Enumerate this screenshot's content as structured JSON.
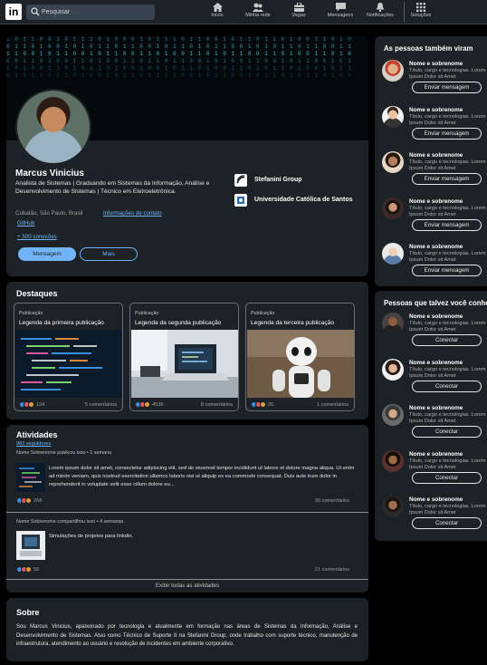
{
  "nav": {
    "logo": "in",
    "search_placeholder": "Pesquisar",
    "items": [
      {
        "label": "Início",
        "icon": "home-icon"
      },
      {
        "label": "Minha rede",
        "icon": "network-icon"
      },
      {
        "label": "Vagas",
        "icon": "briefcase-icon"
      },
      {
        "label": "Mensagens",
        "icon": "message-icon"
      },
      {
        "label": "Notificações",
        "icon": "bell-icon"
      },
      {
        "label": "Soluções",
        "icon": "grid-icon"
      }
    ]
  },
  "profile": {
    "name": "Marcus Vinicius",
    "headline": "Analista de Sistemas | Graduando em Sistemas da Informação, Análise e Desenvolvimento de Sistemas | Técnico em Eletroeletrônica.",
    "location": "Cubatão, São Paulo, Brasil",
    "contact_link": "Informações de contato",
    "github_link": "GitHub",
    "connections": "+ 500 conexões",
    "primary_button": "Mensagem",
    "secondary_button": "Mais",
    "company": "Stefanini Group",
    "education": "Universidade Católica de Santos"
  },
  "highlights": {
    "title": "Destaques",
    "posts": [
      {
        "type": "Publicação",
        "title": "Legenda da primeira publicação",
        "reactions": "124",
        "comments": "5 comentários"
      },
      {
        "type": "Publicação",
        "title": "Legenda da segunda publicação",
        "reactions": "4536",
        "comments": "8 comentários"
      },
      {
        "type": "Publicação",
        "title": "Legenda da terceira publicação",
        "reactions": "20",
        "comments": "1 comentários"
      }
    ]
  },
  "activities": {
    "title": "Atividades",
    "followers": "982 seguidores",
    "items": [
      {
        "meta": "Nome Sobrenome publicou isso • 1 semana",
        "text": "Lorem ipsum dolor sit amet, consectetur adipiscing elit, sed do eiusmod tempor incididunt ut labore et dolore magna aliqua. Ut enim ad minim veniam, quis nostrud exercitation ullamco laboris nisi ut aliquip ex ea commodo consequat. Duis aute irure dolor in reprehenderit in voluptate velit esse cillum dolore eu...",
        "reactions": "268",
        "comments": "30 comentários"
      },
      {
        "meta": "Nome Sobrenome compartilhou isso • 4 semanas",
        "text": "Simulações de projetos para linkdin.",
        "reactions": "56",
        "comments": "21 comentários"
      }
    ],
    "show_all": "Exibir todas as atividades"
  },
  "about": {
    "title": "Sobre",
    "text": "Sou Marcus Vinicius, apaixonado por tecnologia e atualmente em formação nas áreas de Sistemas da Informação, Análise e Desenvolvimento de Sistemas. Atuo como Técnico de Suporte II na Stefanini Group, onde trabalho com suporte técnico, manutenção de infraestrutura, atendimento ao usuário e resolução de incidentes em ambiente corporativo."
  },
  "sidebar_viewed": {
    "title": "As pessoas também viram",
    "people": [
      {
        "name": "Nome e sobrenome",
        "desc": "Título, cargo e tecnologias. Lorem Ipsum Dolor sit Amet",
        "button": "Enviar mensagem"
      },
      {
        "name": "Nome e sobrenome",
        "desc": "Título, cargo e tecnologias. Lorem Ipsum Dolor sit Amet",
        "button": "Enviar mensagem"
      },
      {
        "name": "Nome e sobrenome",
        "desc": "Título, cargo e tecnologias. Lorem Ipsum Dolor sit Amet",
        "button": "Enviar mensagem"
      },
      {
        "name": "Nome e sobrenome",
        "desc": "Título, cargo e tecnologias. Lorem Ipsum Dolor sit Amet",
        "button": "Enviar mensagem"
      },
      {
        "name": "Nome e sobrenome",
        "desc": "Título, cargo e tecnologias. Lorem Ipsum Dolor sit Amet",
        "button": "Enviar mensagem"
      }
    ]
  },
  "sidebar_know": {
    "title": "Pessoas que talvez você conheça",
    "people": [
      {
        "name": "Nome e sobrenome",
        "desc": "Título, cargo e tecnologias. Lorem Ipsum Dolor sit Amet",
        "button": "Conectar"
      },
      {
        "name": "Nome e sobrenome",
        "desc": "Título, cargo e tecnologias. Lorem Ipsum Dolor sit Amet",
        "button": "Conectar"
      },
      {
        "name": "Nome e sobrenome",
        "desc": "Título, cargo e tecnologias. Lorem Ipsum Dolor sit Amet",
        "button": "Conectar"
      },
      {
        "name": "Nome e sobrenome",
        "desc": "Título, cargo e tecnologias. Lorem Ipsum Dolor sit Amet",
        "button": "Conectar"
      },
      {
        "name": "Nome e sobrenome",
        "desc": "Título, cargo e tecnologias. Lorem Ipsum Dolor sit Amet",
        "button": "Conectar"
      }
    ]
  },
  "colors": {
    "accent": "#70b5f9",
    "card": "#1d2226",
    "background": "#000000"
  }
}
